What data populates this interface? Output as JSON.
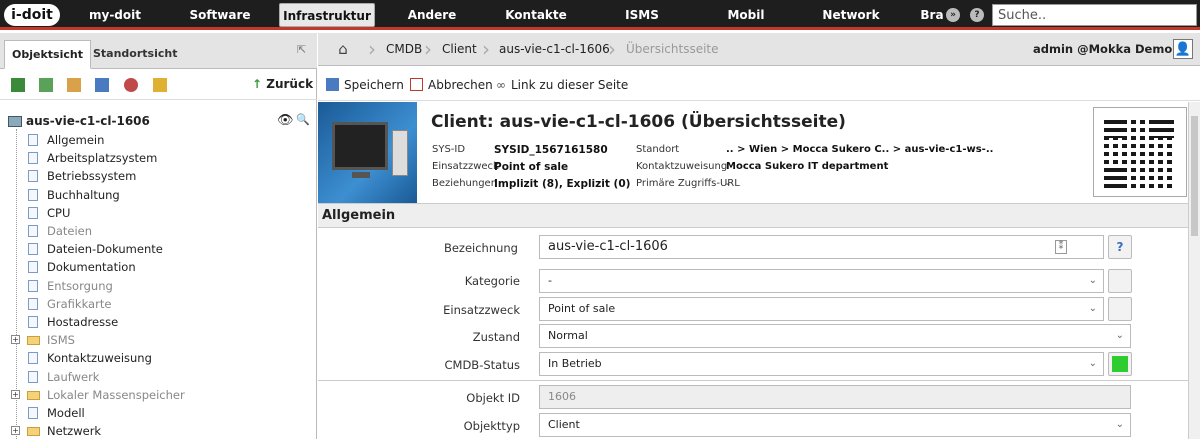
{
  "topbar": {
    "logo": "i-doit",
    "nav": [
      "my-doit",
      "Software",
      "Infrastruktur",
      "Andere",
      "Kontakte",
      "ISMS",
      "Mobil",
      "Network",
      "Bra"
    ],
    "active": "Infrastruktur",
    "search_placeholder": "Suche..",
    "accent": "#c0392b"
  },
  "left": {
    "tabs": [
      "Objektsicht",
      "Standortsicht"
    ],
    "back": "Zurück",
    "root": "aus-vie-c1-cl-1606",
    "items": [
      {
        "label": "Allgemein",
        "dim": false,
        "folder": false
      },
      {
        "label": "Arbeitsplatzsystem",
        "dim": false,
        "folder": false
      },
      {
        "label": "Betriebssystem",
        "dim": false,
        "folder": false
      },
      {
        "label": "Buchhaltung",
        "dim": false,
        "folder": false
      },
      {
        "label": "CPU",
        "dim": false,
        "folder": false
      },
      {
        "label": "Dateien",
        "dim": true,
        "folder": false
      },
      {
        "label": "Dateien-Dokumente",
        "dim": false,
        "folder": false
      },
      {
        "label": "Dokumentation",
        "dim": false,
        "folder": false
      },
      {
        "label": "Entsorgung",
        "dim": true,
        "folder": false
      },
      {
        "label": "Grafikkarte",
        "dim": true,
        "folder": false
      },
      {
        "label": "Hostadresse",
        "dim": false,
        "folder": false
      },
      {
        "label": "ISMS",
        "dim": true,
        "folder": true
      },
      {
        "label": "Kontaktzuweisung",
        "dim": false,
        "folder": false
      },
      {
        "label": "Laufwerk",
        "dim": true,
        "folder": false
      },
      {
        "label": "Lokaler Massenspeicher",
        "dim": true,
        "folder": true
      },
      {
        "label": "Modell",
        "dim": false,
        "folder": false
      },
      {
        "label": "Netzwerk",
        "dim": false,
        "folder": true
      }
    ]
  },
  "breadcrumb": [
    "CMDB",
    "Client",
    "aus-vie-c1-cl-1606",
    "Übersichtsseite"
  ],
  "user": "admin  @Mokka Demo",
  "actions": {
    "save": "Speichern",
    "cancel": "Abbrechen",
    "link": "Link zu dieser Seite"
  },
  "header": {
    "title": "Client: aus-vie-c1-cl-1606 (Übersichtsseite)",
    "sysid_k": "SYS-ID",
    "sysid_v": "SYSID_1567161580",
    "einsatz_k": "Einsatzzweck",
    "einsatz_v": "Point of sale",
    "bez_k": "Beziehungen",
    "bez_v": "Implizit (8), Explizit (0)",
    "standort_k": "Standort",
    "standort_v": ".. > Wien > Mocca Sukero C.. > aus-vie-c1-ws-..",
    "kontakt_k": "Kontaktzuweisung",
    "kontakt_v": "Mocca Sukero IT department",
    "url_k": "Primäre Zugriffs-URL",
    "url_v": "-"
  },
  "section": "Allgemein",
  "form": {
    "bezeichnung_l": "Bezeichnung",
    "bezeichnung_v": "aus-vie-c1-cl-1606",
    "kategorie_l": "Kategorie",
    "kategorie_v": "-",
    "einsatz_l": "Einsatzzweck",
    "einsatz_v": "Point of sale",
    "zustand_l": "Zustand",
    "zustand_v": "Normal",
    "cmdb_l": "CMDB-Status",
    "cmdb_v": "In Betrieb",
    "cmdb_color": "#2ecc2e",
    "objid_l": "Objekt ID",
    "objid_v": "1606",
    "objtyp_l": "Objekttyp",
    "objtyp_v": "Client"
  }
}
